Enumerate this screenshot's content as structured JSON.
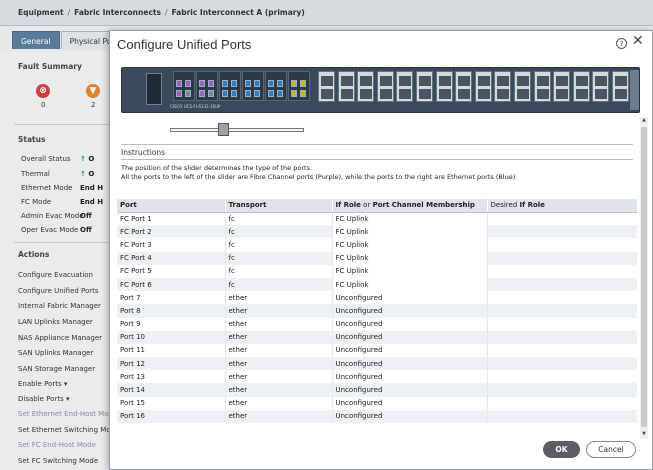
{
  "breadcrumb": [
    "Equipment",
    "Fabric Interconnects",
    "Fabric Interconnect A (primary)"
  ],
  "tabs": [
    "General",
    "Physical Ports"
  ],
  "fault_summary": {
    "title": "Fault Summary",
    "counts": [
      "0",
      "2"
    ]
  },
  "status": {
    "title": "Status",
    "rows": [
      {
        "label": "Overall Status",
        "value": "O"
      },
      {
        "label": "Thermal",
        "value": "O"
      },
      {
        "label": "Ethernet Mode",
        "value": "End H"
      },
      {
        "label": "FC Mode",
        "value": "End H"
      },
      {
        "label": "Admin Evac Mode",
        "value": "Off"
      },
      {
        "label": "Oper Evac Mode",
        "value": "Off"
      }
    ]
  },
  "actions": {
    "title": "Actions",
    "items": [
      "Configure Evacuation",
      "Configure Unified Ports",
      "Internal Fabric Manager",
      "LAN Uplinks Manager",
      "NAS Appliance Manager",
      "SAN Uplinks Manager",
      "SAN Storage Manager",
      "Enable Ports ▾",
      "Disable Ports ▾",
      "Set Ethernet End-Host Mo",
      "Set Ethernet Switching Mo",
      "Set FC End-Host Mode",
      "Set FC Switching Mode"
    ]
  },
  "modal": {
    "title": "Configure Unified Ports",
    "switch_model": "CISCO UCS-FI-6332-16UP",
    "instructions_title": "Instructions",
    "instructions": [
      "The position of the slider determines the type of the ports.",
      "All the ports to the left of the slider are Fibre Channel ports (Purple), while the ports to the right are Ethernet ports (Blue)."
    ],
    "columns": {
      "port": "Port",
      "transport": "Transport",
      "if_role_a": "If Role",
      "if_role_or": " or ",
      "if_role_b": "Port Channel Membership",
      "desired_a": "Desired ",
      "desired_b": "If Role"
    },
    "rows": [
      {
        "port": "FC Port 1",
        "transport": "fc",
        "role": "FC Uplink"
      },
      {
        "port": "FC Port 2",
        "transport": "fc",
        "role": "FC Uplink"
      },
      {
        "port": "FC Port 3",
        "transport": "fc",
        "role": "FC Uplink"
      },
      {
        "port": "FC Port 4",
        "transport": "fc",
        "role": "FC Uplink"
      },
      {
        "port": "FC Port 5",
        "transport": "fc",
        "role": "FC Uplink"
      },
      {
        "port": "FC Port 6",
        "transport": "fc",
        "role": "FC Uplink"
      },
      {
        "port": "Port 7",
        "transport": "ether",
        "role": "Unconfigured"
      },
      {
        "port": "Port 8",
        "transport": "ether",
        "role": "Unconfigured"
      },
      {
        "port": "Port 9",
        "transport": "ether",
        "role": "Unconfigured"
      },
      {
        "port": "Port 10",
        "transport": "ether",
        "role": "Unconfigured"
      },
      {
        "port": "Port 11",
        "transport": "ether",
        "role": "Unconfigured"
      },
      {
        "port": "Port 12",
        "transport": "ether",
        "role": "Unconfigured"
      },
      {
        "port": "Port 13",
        "transport": "ether",
        "role": "Unconfigured"
      },
      {
        "port": "Port 14",
        "transport": "ether",
        "role": "Unconfigured"
      },
      {
        "port": "Port 15",
        "transport": "ether",
        "role": "Unconfigured"
      },
      {
        "port": "Port 16",
        "transport": "ether",
        "role": "Unconfigured"
      }
    ],
    "ok_label": "OK",
    "cancel_label": "Cancel"
  },
  "colors": {
    "fc_port": "#a060c0",
    "eth_port": "#2f7fc0",
    "tab_active": "#5a7a99"
  }
}
